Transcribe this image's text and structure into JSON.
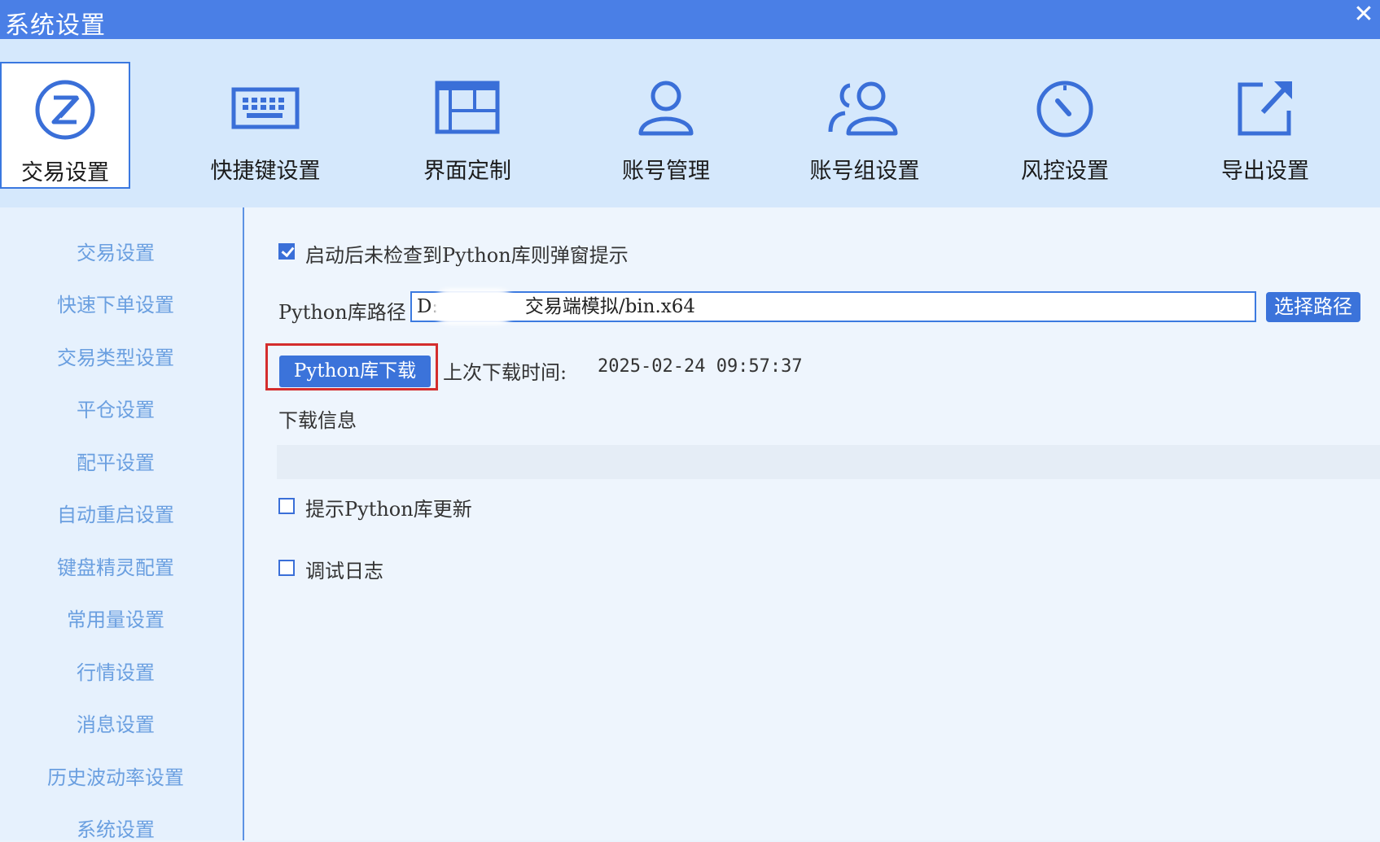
{
  "window": {
    "title": "系统设置",
    "close_glyph": "✕"
  },
  "toolbar": {
    "items": [
      {
        "label": "交易设置",
        "icon": "trade-icon"
      },
      {
        "label": "快捷键设置",
        "icon": "keyboard-icon"
      },
      {
        "label": "界面定制",
        "icon": "layout-icon"
      },
      {
        "label": "账号管理",
        "icon": "user-icon"
      },
      {
        "label": "账号组设置",
        "icon": "user-group-icon"
      },
      {
        "label": "风控设置",
        "icon": "gauge-icon"
      },
      {
        "label": "导出设置",
        "icon": "export-icon"
      }
    ],
    "active": "交易设置"
  },
  "sidebar": {
    "items": [
      "交易设置",
      "快速下单设置",
      "交易类型设置",
      "平仓设置",
      "配平设置",
      "自动重启设置",
      "键盘精灵配置",
      "常用量设置",
      "行情设置",
      "消息设置",
      "历史波动率设置",
      "系统设置"
    ]
  },
  "main": {
    "popup_check": {
      "label": "启动后未检查到Python库则弹窗提示",
      "checked": true
    },
    "path_label": "Python库路径",
    "path_prefix": "D:",
    "path_value": "交易端模拟/bin.x64",
    "choose_button": "选择路径",
    "download_button": "Python库下载",
    "last_download_label": "上次下载时间:",
    "last_download_time": "2025-02-24 09:57:37",
    "download_info_label": "下载信息",
    "update_check": {
      "label": "提示Python库更新",
      "checked": false
    },
    "debug_check": {
      "label": "调试日志",
      "checked": false
    }
  },
  "colors": {
    "accent": "#4a7fe6",
    "button": "#3b73da",
    "highlight": "#d42d2d",
    "sidebar_text": "#6a9fe0"
  }
}
